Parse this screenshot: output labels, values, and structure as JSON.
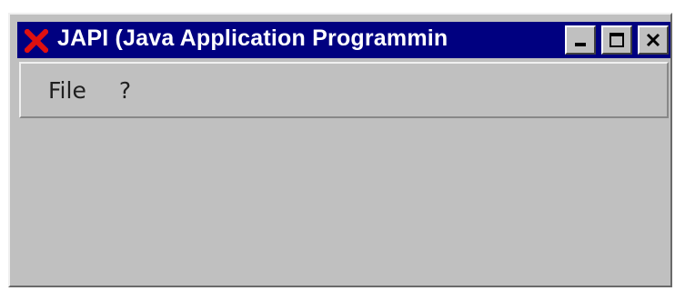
{
  "window": {
    "title": "JAPI (Java Application Programmin",
    "icon": "red-x-icon",
    "buttons": [
      "minimize-icon",
      "maximize-icon",
      "close-icon"
    ]
  },
  "menubar": {
    "items": [
      {
        "label": "File"
      },
      {
        "label": "?"
      }
    ]
  },
  "colors": {
    "titlebar": "#000080",
    "window_bg": "#c0c0c0",
    "icon_red": "#e01010"
  }
}
